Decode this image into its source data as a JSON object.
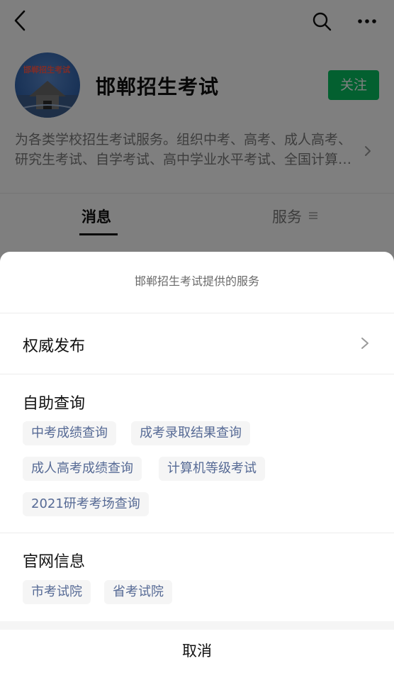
{
  "account": {
    "name": "邯郸招生考试",
    "follow_label": "关注",
    "avatar_text": "邯郸招生考试",
    "description_lines": [
      "为各类学校招生考试服务。组织中考、高考、成人高考、",
      "研究生考试、自学考试、高中学业水平考试、全国计算…"
    ]
  },
  "tabs": [
    {
      "label": "消息",
      "active": true
    },
    {
      "label": "服务",
      "active": false
    }
  ],
  "sheet": {
    "title": "邯郸招生考试提供的服务",
    "authority_row": "权威发布",
    "sections": [
      {
        "label": "自助查询",
        "chips": [
          "中考成绩查询",
          "成考录取结果查询",
          "成人高考成绩查询",
          "计算机等级考试",
          "2021研考考场查询"
        ]
      },
      {
        "label": "官网信息",
        "chips": [
          "市考试院",
          "省考试院"
        ]
      }
    ],
    "cancel_label": "取消"
  },
  "colors": {
    "follow_green": "#07c160",
    "chip_text": "#566a95",
    "chip_bg": "#f5f5f5"
  }
}
